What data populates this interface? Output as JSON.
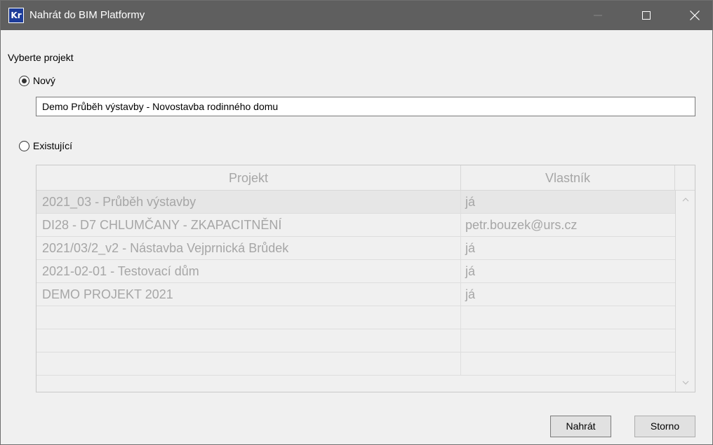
{
  "window": {
    "title": "Nahrát do BIM Platformy",
    "app_icon_text": "Kr",
    "colors": {
      "titlebar": "#5f5f5f",
      "icon": "#1d3c99",
      "body": "#f0f0f0"
    }
  },
  "form": {
    "section_label": "Vyberte projekt",
    "new_option": {
      "label": "Nový",
      "selected": true
    },
    "new_name_value": "Demo Průběh výstavby - Novostavba rodinného domu",
    "existing_option": {
      "label": "Existující",
      "selected": false
    }
  },
  "projects_table": {
    "columns": [
      "Projekt",
      "Vlastník"
    ],
    "rows": [
      {
        "project": "2021_03 - Průběh výstavby",
        "owner": "já"
      },
      {
        "project": "DI28 - D7 CHLUMČANY - ZKAPACITNĚNÍ",
        "owner": "petr.bouzek@urs.cz"
      },
      {
        "project": "2021/03/2_v2 - Nástavba Vejprnická Brůdek",
        "owner": "já"
      },
      {
        "project": "2021-02-01 - Testovací dům",
        "owner": "já"
      },
      {
        "project": "DEMO PROJEKT 2021",
        "owner": "já"
      }
    ]
  },
  "buttons": {
    "upload": "Nahrát",
    "cancel": "Storno"
  }
}
